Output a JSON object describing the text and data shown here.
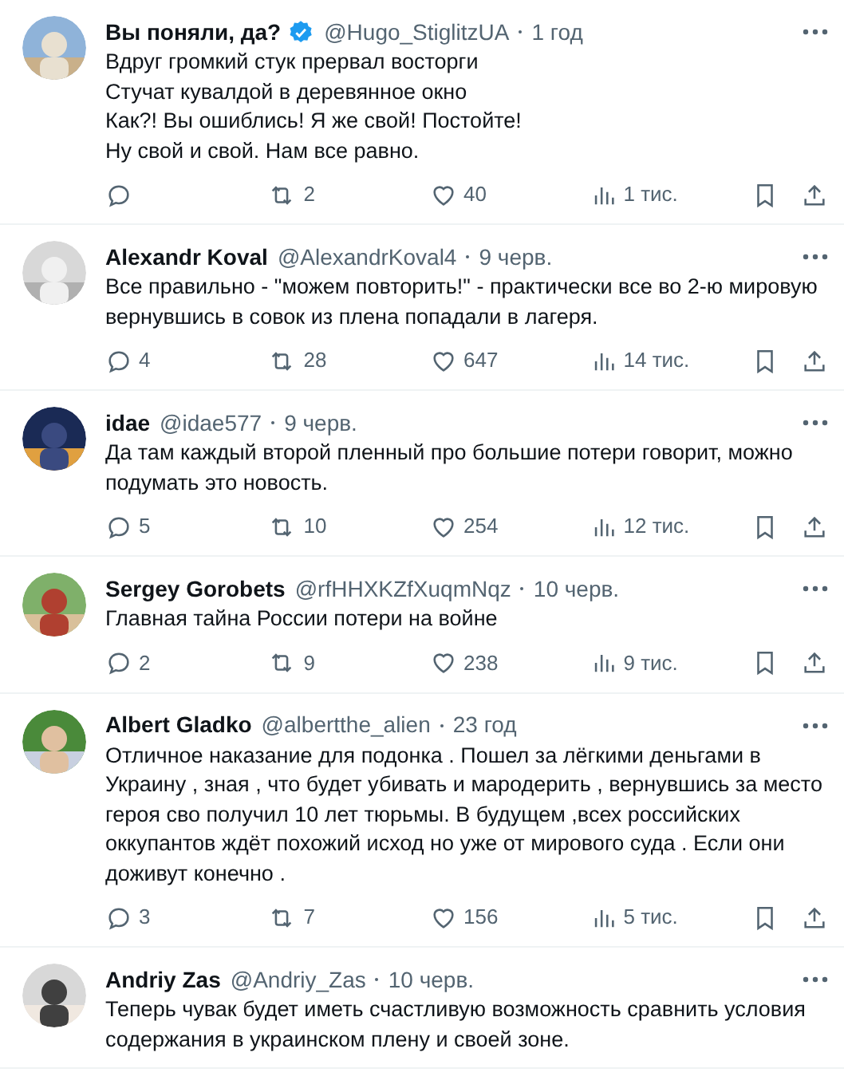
{
  "tweets": [
    {
      "name": "Вы поняли, да?",
      "verified": true,
      "handle": "@Hugo_StiglitzUA",
      "time": "1 год",
      "body": [
        "Вдруг громкий стук прервал восторги",
        "Стучат кувалдой в деревянное окно",
        "Как?! Вы ошиблись! Я же свой! Постойте!",
        "Ну свой и свой. Нам все равно."
      ],
      "metrics": {
        "reposts": "2",
        "likes": "40",
        "views": "1 тис."
      }
    },
    {
      "name": "Alexandr Koval",
      "verified": false,
      "handle": "@AlexandrKoval4",
      "time": "9 черв.",
      "body": [
        "Все правильно - \"можем повторить!\" - практически все во 2-ю мировую вернувшись в совок из плена попадали в лагеря."
      ],
      "metrics": {
        "replies": "4",
        "reposts": "28",
        "likes": "647",
        "views": "14 тис."
      }
    },
    {
      "name": "idae",
      "verified": false,
      "handle": "@idae577",
      "time": "9 черв.",
      "body": [
        "Да там каждый второй пленный про большие потери говорит, можно подумать это новость."
      ],
      "metrics": {
        "replies": "5",
        "reposts": "10",
        "likes": "254",
        "views": "12 тис."
      }
    },
    {
      "name": "Sergey Gorobets",
      "verified": false,
      "handle": "@rfHHXKZfXuqmNqz",
      "time": "10 черв.",
      "body": [
        "Главная тайна России потери на войне"
      ],
      "metrics": {
        "replies": "2",
        "reposts": "9",
        "likes": "238",
        "views": "9 тис."
      }
    },
    {
      "name": "Albert Gladko",
      "verified": false,
      "handle": "@albertthe_alien",
      "time": "23 год",
      "body": [
        "Отличное наказание для подонка . Пошел за лёгкими деньгами в Украину , зная , что будет убивать и мародерить , вернувшись за место героя сво получил 10 лет тюрьмы. В будущем ,всех российских оккупантов ждёт похожий исход но уже от мирового суда . Если они доживут конечно ."
      ],
      "metrics": {
        "replies": "3",
        "reposts": "7",
        "likes": "156",
        "views": "5 тис."
      }
    },
    {
      "name": "Andriy Zas",
      "verified": false,
      "handle": "@Andriy_Zas",
      "time": "10 черв.",
      "body": [
        "Теперь чувак будет иметь счастливую возможность сравнить условия содержания в украинском плену и своей зоне."
      ]
    }
  ]
}
